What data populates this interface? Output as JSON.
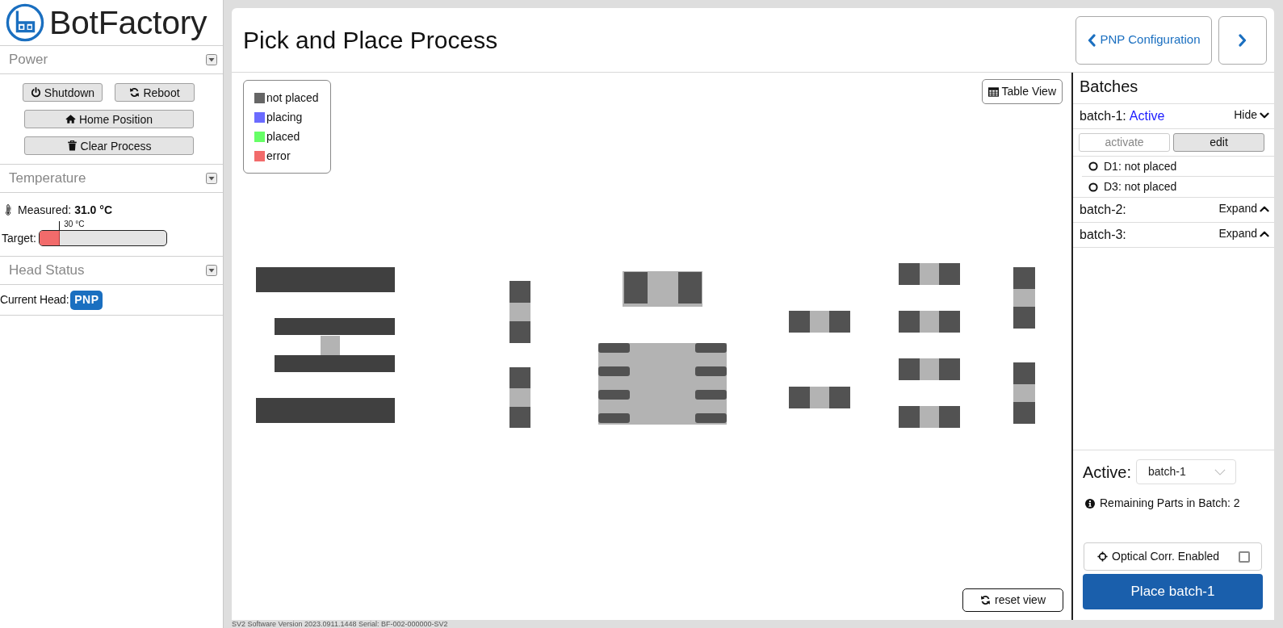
{
  "logo": {
    "text": "BotFactory"
  },
  "sidebar": {
    "power": {
      "title": "Power",
      "expanded": true,
      "buttons": [
        {
          "label": "Shutdown"
        },
        {
          "label": "Reboot"
        },
        {
          "label": "Home Position"
        },
        {
          "label": "Clear Process"
        }
      ]
    },
    "temperature": {
      "title": "Temperature",
      "expanded": true,
      "measured_label": "Measured:",
      "measured_value": "31.0 °C",
      "target_label": "Target:",
      "target_reading": "30 °C",
      "level": 0.16
    },
    "head_status": {
      "title": "Head Status",
      "expanded": true,
      "label": "Current Head:",
      "head": "PNP"
    }
  },
  "header": {
    "title": "Pick and Place Process",
    "back_button": "PNP Configuration"
  },
  "canvas": {
    "legend": [
      {
        "label": "not placed",
        "color": "#666666"
      },
      {
        "label": "placing",
        "color": "#6b6bff"
      },
      {
        "label": "placed",
        "color": "#66ff66"
      },
      {
        "label": "error",
        "color": "#f26b6b"
      }
    ],
    "table_view_button": "Table View",
    "reset_button": "reset view"
  },
  "batches": {
    "title": "Batches",
    "items": [
      {
        "name": "batch-1:",
        "status": "Active",
        "expanded": true,
        "toggle": "Hide",
        "actions": [
          {
            "label": "activate",
            "disabled": true
          },
          {
            "label": "edit",
            "disabled": false
          }
        ],
        "parts": [
          {
            "label": "D1: not placed"
          },
          {
            "label": "D3: not placed"
          }
        ]
      },
      {
        "name": "batch-2:",
        "expanded": false,
        "toggle": "Expand"
      },
      {
        "name": "batch-3:",
        "expanded": false,
        "toggle": "Expand"
      }
    ],
    "active_label": "Active:",
    "active_select": {
      "value": "batch-1"
    },
    "info": "Remaining Parts in Batch: 2",
    "optical_correction": {
      "label": "Optical Corr. Enabled",
      "checked": false
    },
    "place_button": "Place batch-1"
  },
  "footer": {
    "version": "SV2 Software Version 2023.0911.1448 Serial: BF-002-000000-SV2"
  }
}
